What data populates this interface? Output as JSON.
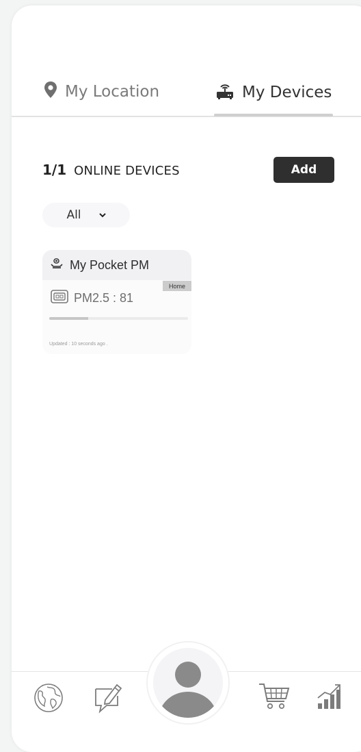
{
  "tabs": {
    "location_label": "My Location",
    "devices_label": "My Devices",
    "active": "devices"
  },
  "summary": {
    "count": "1/1",
    "label": "ONLINE DEVICES",
    "add_label": "Add"
  },
  "filter": {
    "selected": "All",
    "chevron": "⌄"
  },
  "devices": [
    {
      "name": "My Pocket PM",
      "tag": "Home",
      "reading": "PM2.5 : 81",
      "progress": 0.28,
      "updated": "Updated : 10 seconds ago ."
    }
  ],
  "icons": {
    "location": "map-marker-icon",
    "devices": "router-icon",
    "device": "device-icon",
    "sensor": "sensor-icon",
    "globe": "globe-icon",
    "edit": "edit-chat-icon",
    "profile": "user-avatar-icon",
    "cart": "cart-icon",
    "stats": "stats-icon"
  },
  "colors": {
    "active_tab_text": "#333333",
    "inactive_tab_text": "#7a7a7a",
    "add_button_bg": "#2f2f2f",
    "indicator": "#cfcfcf"
  }
}
